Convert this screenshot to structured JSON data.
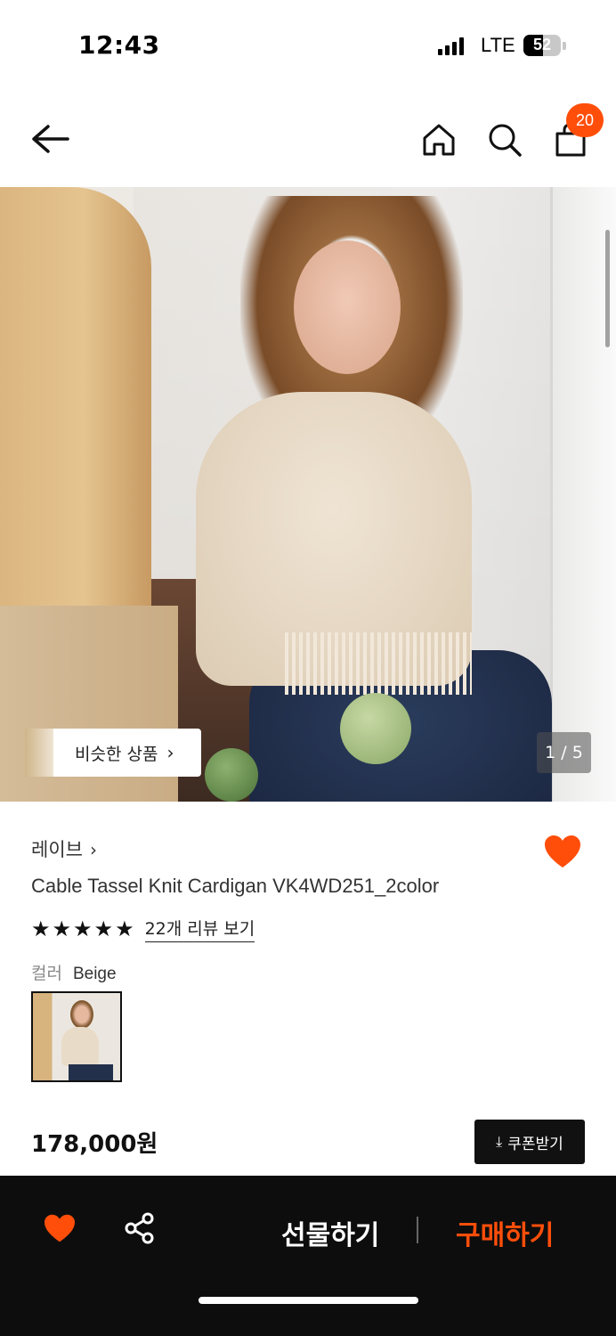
{
  "status_bar": {
    "time": "12:43",
    "network": "LTE",
    "battery": "52",
    "battery_level": 0.52
  },
  "nav": {
    "cart_count": "20",
    "icons": [
      "back-arrow-icon",
      "home-icon",
      "search-icon",
      "shopping-bag-icon"
    ]
  },
  "gallery": {
    "similar_label": "비슷한 상품",
    "counter": "1 / 5"
  },
  "product": {
    "brand": "레이브",
    "title": "Cable Tassel Knit Cardigan VK4WD251_2color",
    "rating_stars": 5,
    "reviews_link": "22개 리뷰 보기",
    "color_label": "컬러",
    "color_value": "Beige",
    "price": "178,000원",
    "coupon_button": "쿠폰받기"
  },
  "bottom_bar": {
    "gift_label": "선물하기",
    "buy_label": "구매하기"
  },
  "colors": {
    "accent": "#ff4e0a",
    "bottom_bar_bg": "#0d0d0d"
  }
}
